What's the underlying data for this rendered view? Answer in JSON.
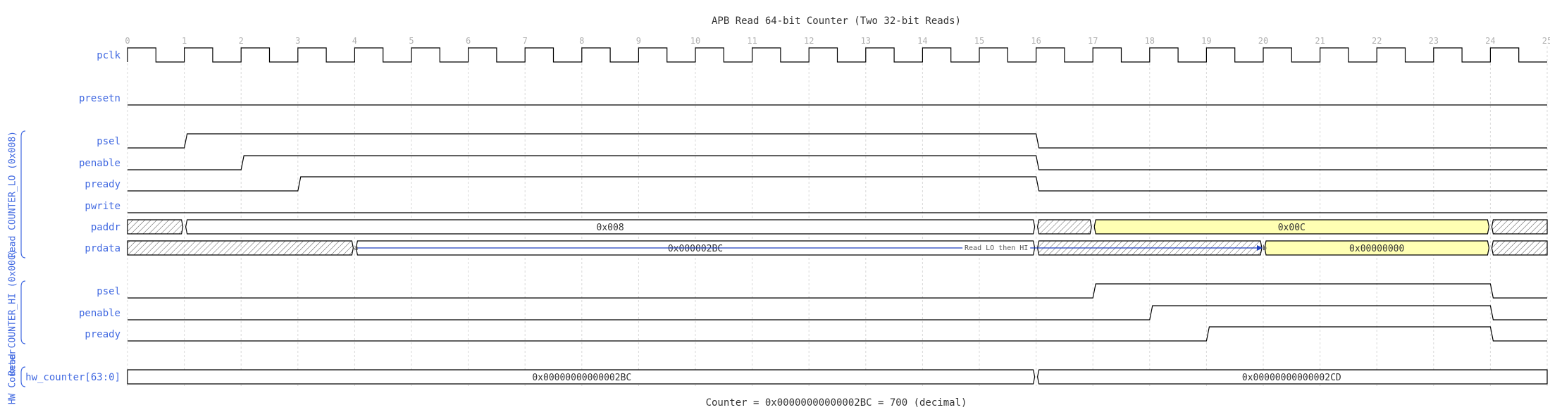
{
  "title": "APB Read 64-bit Counter (Two 32-bit Reads)",
  "footer": "Counter = 0x00000000000002BC = 700 (decimal)",
  "period_count": 25,
  "tick_labels": [
    "0",
    "1",
    "2",
    "3",
    "4",
    "5",
    "6",
    "7",
    "8",
    "9",
    "10",
    "11",
    "12",
    "13",
    "14",
    "15",
    "16",
    "17",
    "18",
    "19",
    "20",
    "21",
    "22",
    "23",
    "24",
    "25"
  ],
  "groups": [
    {
      "label": "Read COUNTER_LO (0x008)",
      "first_row": 2,
      "last_row": 7
    },
    {
      "label": "Read COUNTER_HI (0x00C)",
      "first_row": 8,
      "last_row": 10
    },
    {
      "label": "HW Counter",
      "first_row": 11,
      "last_row": 11
    }
  ],
  "signals": [
    {
      "name": "pclk",
      "type": "clock"
    },
    {
      "name": "presetn",
      "type": "bit",
      "wave": [
        [
          0,
          25,
          0
        ]
      ]
    },
    {
      "name": "psel",
      "type": "bit",
      "wave": [
        [
          0,
          1,
          0
        ],
        [
          1,
          16,
          1
        ],
        [
          16,
          25,
          0
        ]
      ]
    },
    {
      "name": "penable",
      "type": "bit",
      "wave": [
        [
          0,
          2,
          0
        ],
        [
          2,
          16,
          1
        ],
        [
          16,
          25,
          0
        ]
      ]
    },
    {
      "name": "pready",
      "type": "bit",
      "wave": [
        [
          0,
          3,
          0
        ],
        [
          3,
          16,
          1
        ],
        [
          16,
          25,
          0
        ]
      ]
    },
    {
      "name": "pwrite",
      "type": "bit",
      "wave": [
        [
          0,
          25,
          0
        ]
      ]
    },
    {
      "name": "paddr",
      "type": "bus",
      "segments": [
        {
          "from": 0,
          "to": 1,
          "kind": "x"
        },
        {
          "from": 1,
          "to": 16,
          "kind": "data",
          "value": "0x008"
        },
        {
          "from": 16,
          "to": 17,
          "kind": "x"
        },
        {
          "from": 17,
          "to": 24,
          "kind": "data",
          "value": "0x00C",
          "highlight": true
        },
        {
          "from": 24,
          "to": 25,
          "kind": "x"
        }
      ]
    },
    {
      "name": "prdata",
      "type": "bus",
      "segments": [
        {
          "from": 0,
          "to": 4,
          "kind": "x"
        },
        {
          "from": 4,
          "to": 16,
          "kind": "data",
          "value": "0x000002BC"
        },
        {
          "from": 16,
          "to": 20,
          "kind": "x"
        },
        {
          "from": 20,
          "to": 24,
          "kind": "data",
          "value": "0x00000000",
          "highlight": true
        },
        {
          "from": 24,
          "to": 25,
          "kind": "x"
        }
      ]
    },
    {
      "name": "psel",
      "type": "bit",
      "wave": [
        [
          0,
          17,
          0
        ],
        [
          17,
          24,
          1
        ],
        [
          24,
          25,
          0
        ]
      ]
    },
    {
      "name": "penable",
      "type": "bit",
      "wave": [
        [
          0,
          18,
          0
        ],
        [
          18,
          24,
          1
        ],
        [
          24,
          25,
          0
        ]
      ]
    },
    {
      "name": "pready",
      "type": "bit",
      "wave": [
        [
          0,
          19,
          0
        ],
        [
          19,
          24,
          1
        ],
        [
          24,
          25,
          0
        ]
      ]
    },
    {
      "name": "hw_counter[63:0]",
      "type": "bus",
      "segments": [
        {
          "from": 0,
          "to": 16,
          "kind": "data",
          "value": "0x00000000000002BC"
        },
        {
          "from": 16,
          "to": 25,
          "kind": "data",
          "value": "0x00000000000002CD"
        }
      ]
    }
  ],
  "annotations": [
    {
      "row": 7,
      "from": 4,
      "to": 20,
      "start_marker": "a",
      "end_marker": "b",
      "text": "Read LO then HI",
      "color": "#1f3fbf"
    }
  ],
  "colors": {
    "label": "#4169e1",
    "highlight": "#ffffb3",
    "arrow": "#1f3fbf"
  }
}
